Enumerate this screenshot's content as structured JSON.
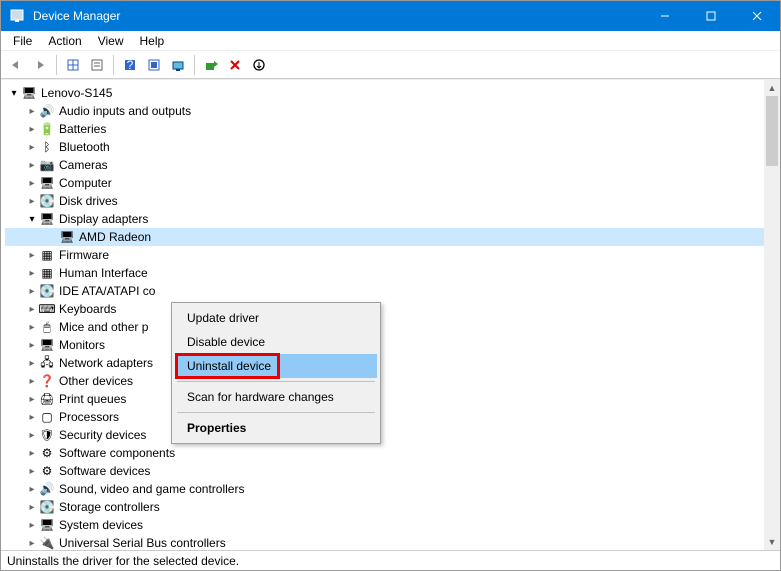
{
  "window": {
    "title": "Device Manager"
  },
  "menubar": [
    "File",
    "Action",
    "View",
    "Help"
  ],
  "tree": {
    "root": "Lenovo-S145",
    "items": [
      {
        "label": "Audio inputs and outputs",
        "icon": "🔊"
      },
      {
        "label": "Batteries",
        "icon": "🔋"
      },
      {
        "label": "Bluetooth",
        "icon": "ᛒ"
      },
      {
        "label": "Cameras",
        "icon": "📷"
      },
      {
        "label": "Computer",
        "icon": "🖥"
      },
      {
        "label": "Disk drives",
        "icon": "💽"
      },
      {
        "label": "Display adapters",
        "icon": "🖥",
        "expanded": true,
        "child": {
          "label": "AMD Radeon",
          "icon": "🖥",
          "selected": true
        }
      },
      {
        "label": "Firmware",
        "icon": "▦"
      },
      {
        "label": "Human Interface",
        "icon": "▦"
      },
      {
        "label": "IDE ATA/ATAPI co",
        "icon": "💽"
      },
      {
        "label": "Keyboards",
        "icon": "⌨"
      },
      {
        "label": "Mice and other p",
        "icon": "🖱"
      },
      {
        "label": "Monitors",
        "icon": "🖥"
      },
      {
        "label": "Network adapters",
        "icon": "🖧"
      },
      {
        "label": "Other devices",
        "icon": "❓"
      },
      {
        "label": "Print queues",
        "icon": "🖨"
      },
      {
        "label": "Processors",
        "icon": "▢"
      },
      {
        "label": "Security devices",
        "icon": "🛡"
      },
      {
        "label": "Software components",
        "icon": "⚙"
      },
      {
        "label": "Software devices",
        "icon": "⚙"
      },
      {
        "label": "Sound, video and game controllers",
        "icon": "🔊"
      },
      {
        "label": "Storage controllers",
        "icon": "💽"
      },
      {
        "label": "System devices",
        "icon": "🖥"
      },
      {
        "label": "Universal Serial Bus controllers",
        "icon": "🔌"
      }
    ]
  },
  "context_menu": {
    "items": [
      {
        "label": "Update driver"
      },
      {
        "label": "Disable device"
      },
      {
        "label": "Uninstall device",
        "highlight": true,
        "redbox": true
      },
      {
        "sep": true
      },
      {
        "label": "Scan for hardware changes"
      },
      {
        "sep": true
      },
      {
        "label": "Properties",
        "bold": true
      }
    ]
  },
  "statusbar": {
    "text": "Uninstalls the driver for the selected device."
  }
}
